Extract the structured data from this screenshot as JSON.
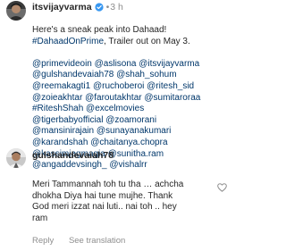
{
  "post": {
    "username": "itsvijayvarma",
    "separator": "•",
    "time": "3 h",
    "caption": {
      "line1": "Here's a sneak peak into Dahaad!",
      "line2_tag": "#DahaadOnPrime",
      "line2_text": ", Trailer out on May 3.",
      "mentions": [
        [
          "@primevideoin",
          " @aslisona",
          " @itsvijayvarma"
        ],
        [
          "@gulshandevaiah78",
          " @shah_sohum"
        ],
        [
          "@reemakagti1",
          " @ruchoberoi",
          " @ritesh_sid"
        ],
        [
          "@zoieakhtar",
          " @faroutakhtar",
          " @sumitaroraa"
        ],
        [
          "#RiteshShah",
          " @excelmovies"
        ],
        [
          "@tigerbabyofficial",
          " @zoamorani"
        ],
        [
          "@mansinirajain",
          " @sunayanakumari"
        ],
        [
          "@karandshah",
          " @chaitanya.chopra"
        ],
        [
          "@kassimjagmagia",
          " @sunitha.ram"
        ],
        [
          "@angaddevsingh_",
          " @vishalrr"
        ]
      ]
    }
  },
  "comment": {
    "username": "gulshandevaiah78",
    "lines": [
      "Meri Tammannah toh tu tha … achcha",
      "dhokha Diya hai tune mujhe. Thank",
      "God meri izzat nai luti.. nai toh .. hey",
      "ram"
    ],
    "reply_label": "Reply",
    "translate_label": "See translation"
  },
  "colors": {
    "text": "#262626",
    "link": "#00376b",
    "muted": "#8e8e8e",
    "verified": "#3897f0"
  },
  "icons": {
    "verified": "verified-badge-icon",
    "heart": "heart-outline-icon"
  }
}
